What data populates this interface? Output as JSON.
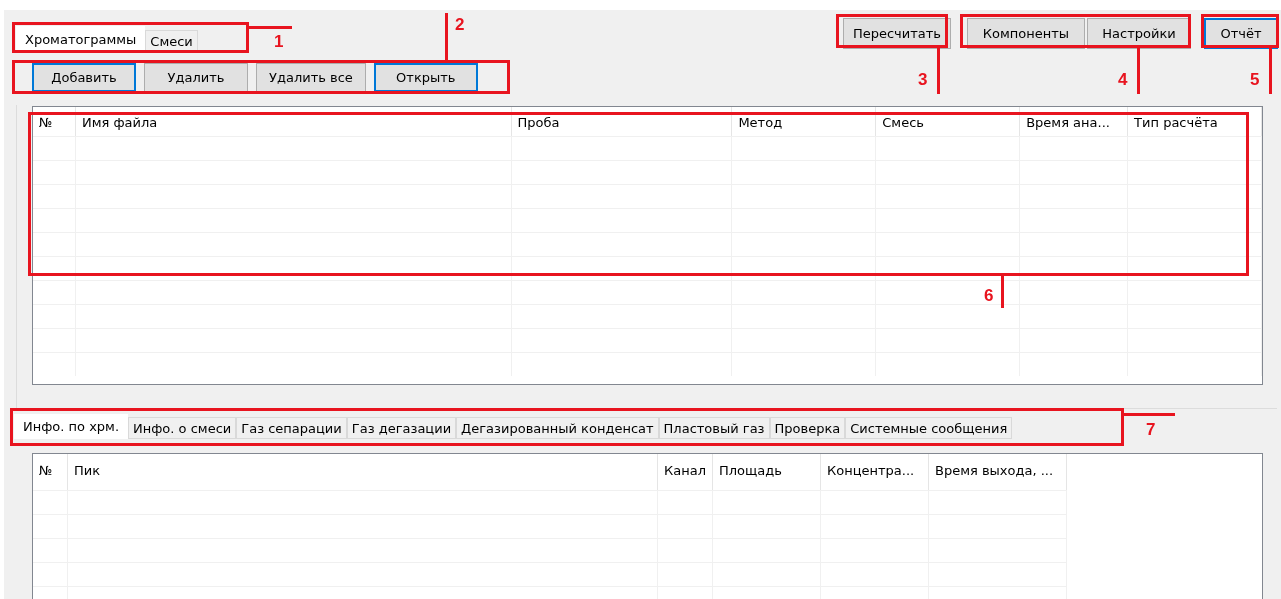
{
  "files_tabs": [
    {
      "label": "Хроматограммы",
      "selected": true
    },
    {
      "label": "Смеси",
      "selected": false
    }
  ],
  "file_buttons": [
    {
      "label": "Добавить",
      "focused": true
    },
    {
      "label": "Удалить",
      "focused": false
    },
    {
      "label": "Удалить все",
      "focused": false
    },
    {
      "label": "Открыть",
      "focused": true
    }
  ],
  "action_buttons": [
    {
      "label": "Пересчитать",
      "focused": false
    },
    {
      "label": "Компоненты",
      "focused": false
    },
    {
      "label": "Настройки",
      "focused": false
    },
    {
      "label": "Отчёт",
      "focused": true
    }
  ],
  "files_table": {
    "columns": [
      "№",
      "Имя файла",
      "Проба",
      "Метод",
      "Смесь",
      "Время ана...",
      "Тип расчёта"
    ]
  },
  "info_tabs": [
    {
      "label": "Инфо. по хрм.",
      "selected": true
    },
    {
      "label": "Инфо. о смеси",
      "selected": false
    },
    {
      "label": "Газ сепарации",
      "selected": false
    },
    {
      "label": "Газ дегазации",
      "selected": false
    },
    {
      "label": "Дегазированный конденсат",
      "selected": false
    },
    {
      "label": "Пластовый газ",
      "selected": false
    },
    {
      "label": "Проверка",
      "selected": false
    },
    {
      "label": "Системные сообщения",
      "selected": false
    }
  ],
  "peaks_table": {
    "columns": [
      "№",
      "Пик",
      "Канал",
      "Площадь",
      "Концентра...",
      "Время выхода, ..."
    ]
  },
  "annotations": [
    {
      "label": "1"
    },
    {
      "label": "2"
    },
    {
      "label": "3"
    },
    {
      "label": "4"
    },
    {
      "label": "5"
    },
    {
      "label": "6"
    },
    {
      "label": "7"
    }
  ]
}
